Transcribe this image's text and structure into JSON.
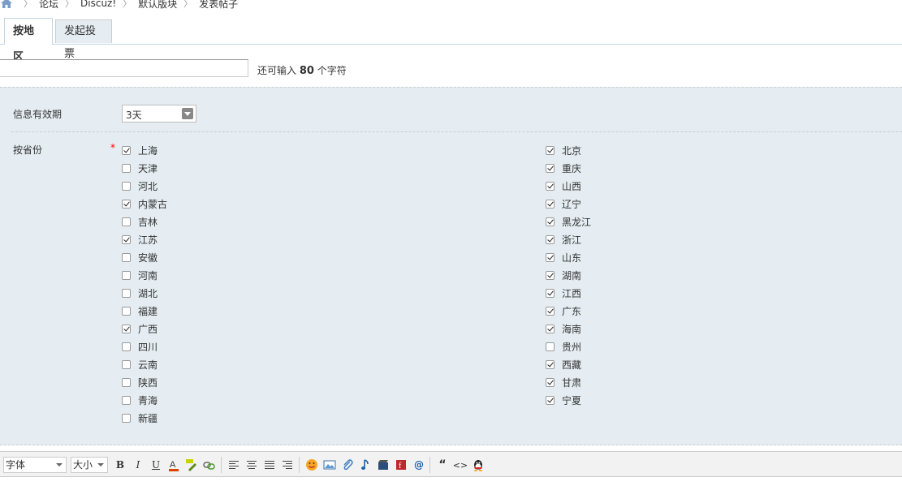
{
  "breadcrumb": {
    "items": [
      "论坛",
      "Discuz!",
      "默认版块",
      "发表帖子"
    ]
  },
  "tabs": [
    {
      "label": "按地区",
      "active": true
    },
    {
      "label": "发起投票",
      "active": false
    }
  ],
  "subject": {
    "value": "",
    "hint_prefix": "还可输入",
    "remaining": "80",
    "hint_suffix": "个字符"
  },
  "expiry": {
    "label": "信息有效期",
    "selected": "3天"
  },
  "provinces": {
    "label": "按省份",
    "required_mark": "*",
    "left": [
      {
        "name": "上海",
        "checked": true
      },
      {
        "name": "天津",
        "checked": false
      },
      {
        "name": "河北",
        "checked": false
      },
      {
        "name": "内蒙古",
        "checked": true
      },
      {
        "name": "吉林",
        "checked": false
      },
      {
        "name": "江苏",
        "checked": true
      },
      {
        "name": "安徽",
        "checked": false
      },
      {
        "name": "河南",
        "checked": false
      },
      {
        "name": "湖北",
        "checked": false
      },
      {
        "name": "福建",
        "checked": false
      },
      {
        "name": "广西",
        "checked": true
      },
      {
        "name": "四川",
        "checked": false
      },
      {
        "name": "云南",
        "checked": false
      },
      {
        "name": "陕西",
        "checked": false
      },
      {
        "name": "青海",
        "checked": false
      },
      {
        "name": "新疆",
        "checked": false
      }
    ],
    "right": [
      {
        "name": "北京",
        "checked": true
      },
      {
        "name": "重庆",
        "checked": true
      },
      {
        "name": "山西",
        "checked": true
      },
      {
        "name": "辽宁",
        "checked": true
      },
      {
        "name": "黑龙江",
        "checked": true
      },
      {
        "name": "浙江",
        "checked": true
      },
      {
        "name": "山东",
        "checked": true
      },
      {
        "name": "湖南",
        "checked": true
      },
      {
        "name": "江西",
        "checked": true
      },
      {
        "name": "广东",
        "checked": true
      },
      {
        "name": "海南",
        "checked": true
      },
      {
        "name": "贵州",
        "checked": false
      },
      {
        "name": "西藏",
        "checked": true
      },
      {
        "name": "甘肃",
        "checked": true
      },
      {
        "name": "宁夏",
        "checked": true
      }
    ]
  },
  "editor": {
    "font_label": "字体",
    "size_label": "大小",
    "bold": "B",
    "italic": "I",
    "underline": "U",
    "color_letter": "A",
    "quote": "“",
    "code": "<>",
    "at": "@",
    "colors": {
      "text_color": "#e04000",
      "accent": "#1a62b0"
    }
  }
}
